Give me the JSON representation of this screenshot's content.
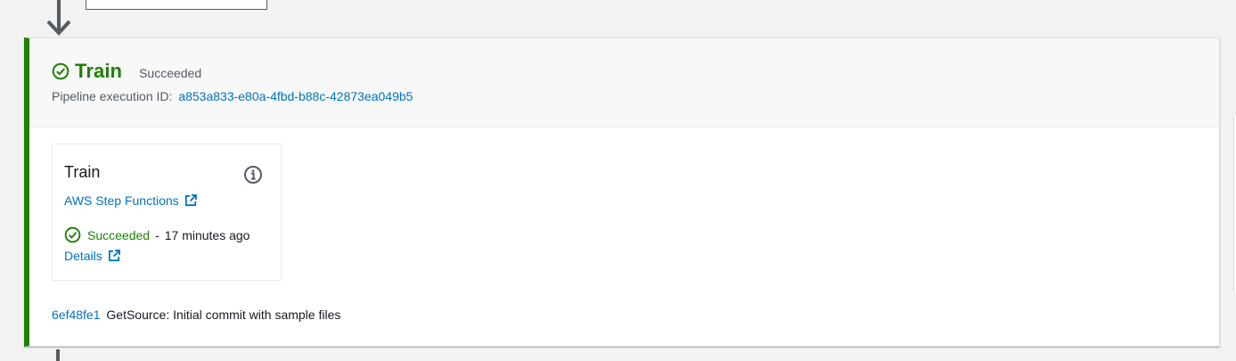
{
  "stage": {
    "title": "Train",
    "status": "Succeeded",
    "execution_label": "Pipeline execution ID:",
    "execution_id": "a853a833-e80a-4fbd-b88c-42873ea049b5",
    "accent_color": "#1d8102"
  },
  "action": {
    "name": "Train",
    "provider": "AWS Step Functions",
    "status": "Succeeded",
    "separator": "-",
    "time_ago": "17 minutes ago",
    "details_label": "Details"
  },
  "source_revision": {
    "commit_id": "6ef48fe1",
    "message": "GetSource: Initial commit with sample files"
  },
  "icons": {
    "status": "check-circle-icon",
    "info": "info-icon",
    "external": "external-link-icon",
    "connector": "arrow-down-icon"
  },
  "colors": {
    "success": "#1d8102",
    "link": "#0073bb",
    "background": "#f2f2f2"
  }
}
